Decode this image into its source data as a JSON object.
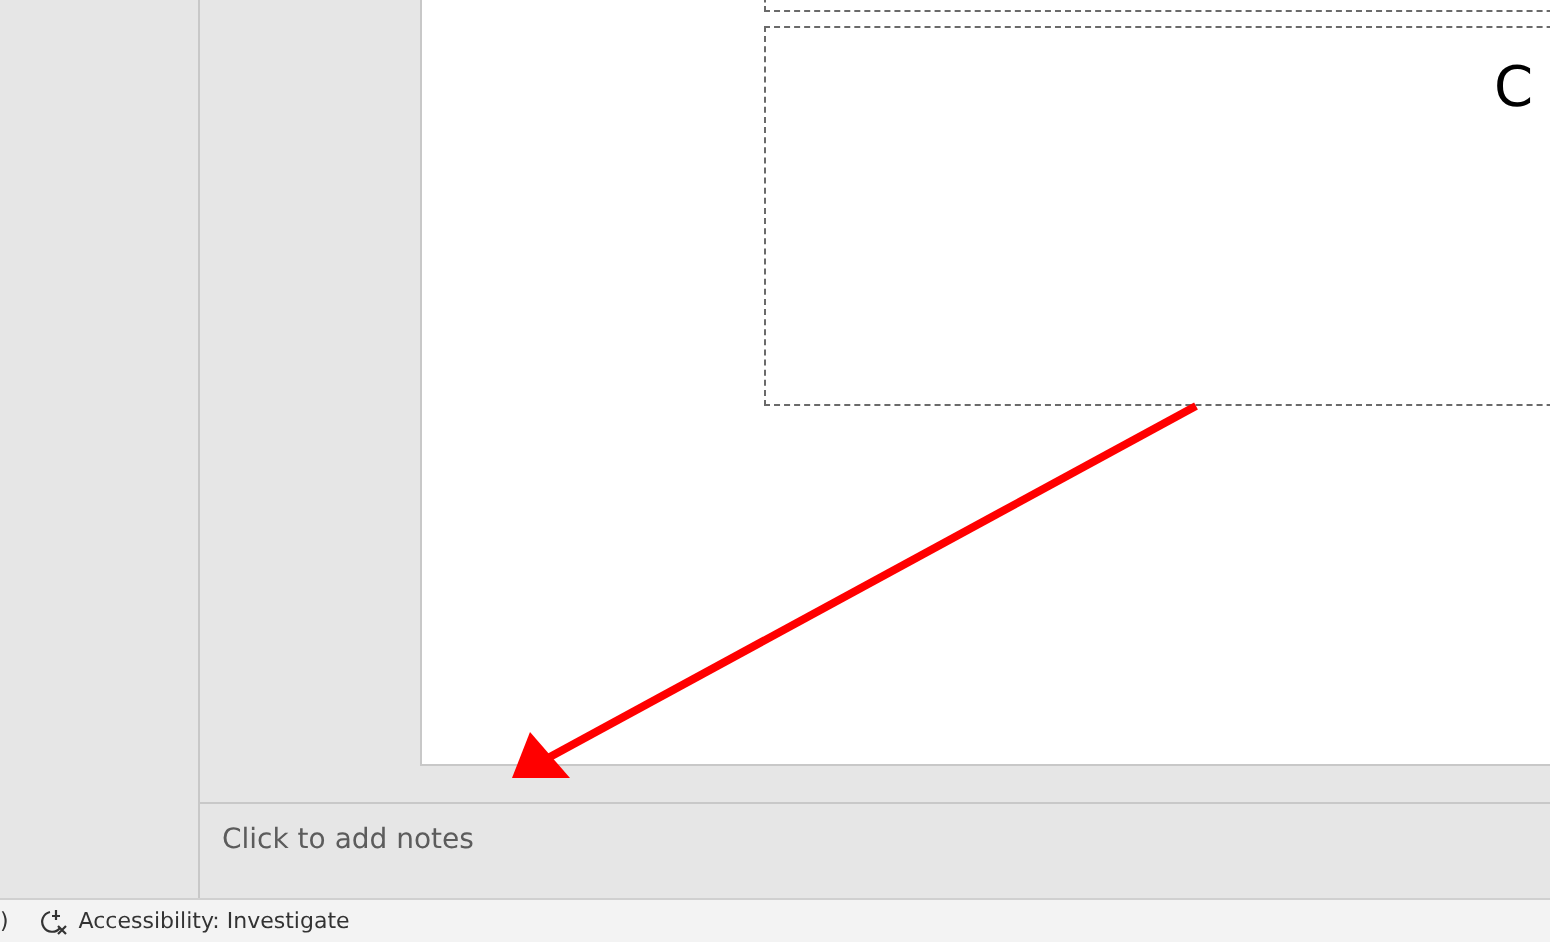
{
  "slide": {
    "placeholders": [
      {
        "kind": "top"
      },
      {
        "kind": "content",
        "text": "C"
      }
    ]
  },
  "notes": {
    "placeholder": "Click to add notes"
  },
  "status_bar": {
    "items": [
      {
        "kind": "text",
        "text": ")"
      },
      {
        "kind": "accessibility",
        "text": "Accessibility: Investigate"
      }
    ]
  }
}
